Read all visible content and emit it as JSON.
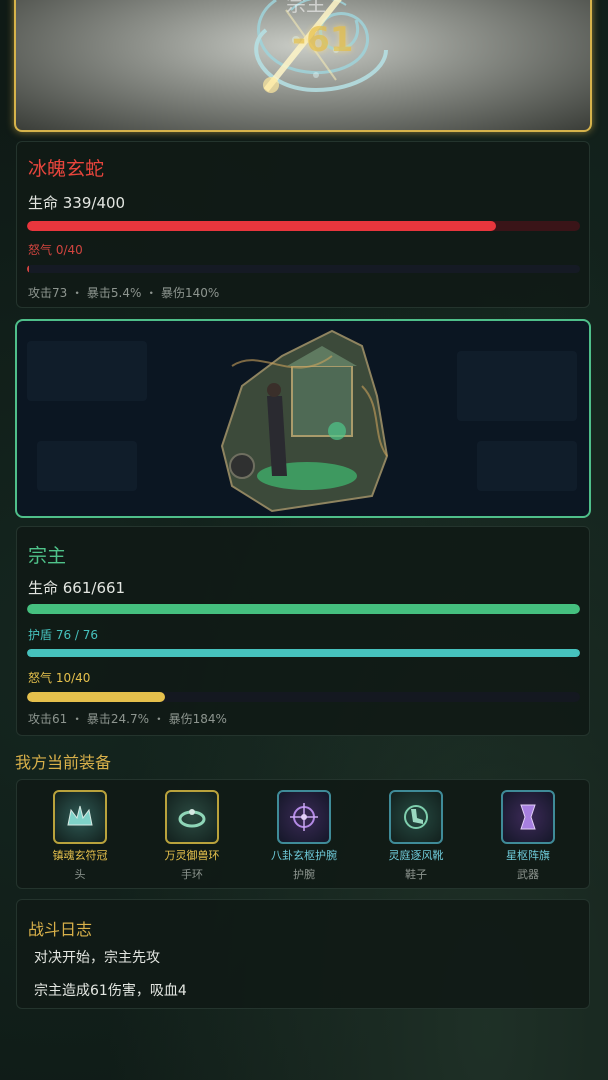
{
  "top_scene": {
    "enemy_name_ghost": "宗主",
    "damage_number": "-61"
  },
  "enemy": {
    "name": "冰魄玄蛇",
    "hp_text": "生命 339/400",
    "hp_ratio": 0.8475,
    "rage_label": "怒气 0/40",
    "rage_ratio": 0.0,
    "substats": "攻击73 ・ 暴击5.4% ・ 暴伤140%",
    "name_color": "#e8453c",
    "hp_color": "#e8363d"
  },
  "player": {
    "name": "宗主",
    "hp_text": "生命 661/661",
    "hp_ratio": 1.0,
    "shield_label": "护盾 76 / 76",
    "shield_ratio": 1.0,
    "rage_label": "怒气 10/40",
    "rage_ratio": 0.25,
    "substats": "攻击61 ・ 暴击24.7% ・ 暴伤184%",
    "name_color": "#4fc38a",
    "hp_color": "#45c07f",
    "shield_color": "#46c2bd",
    "rage_color": "#e5c04c"
  },
  "equipment": {
    "title": "我方当前装备",
    "items": [
      {
        "name": "镇魂玄符冠",
        "slot": "头",
        "icon": "crown-icon",
        "name_color": "#e5c04c",
        "border": "#b9a23c"
      },
      {
        "name": "万灵御兽环",
        "slot": "手环",
        "icon": "bracelet-icon",
        "name_color": "#e5c04c",
        "border": "#b9a23c"
      },
      {
        "name": "八卦玄枢护腕",
        "slot": "护腕",
        "icon": "bagua-wrist-icon",
        "name_color": "#6ec9d8",
        "border": "#3f8b98"
      },
      {
        "name": "灵庭逐风靴",
        "slot": "鞋子",
        "icon": "boots-icon",
        "name_color": "#6ec9d8",
        "border": "#3f8b98"
      },
      {
        "name": "星枢阵旗",
        "slot": "武器",
        "icon": "banner-icon",
        "name_color": "#6ec9d8",
        "border": "#3f8b98"
      }
    ]
  },
  "battle_log": {
    "title": "战斗日志",
    "lines": [
      "对决开始，宗主先攻",
      "宗主造成61伤害，吸血4"
    ]
  }
}
